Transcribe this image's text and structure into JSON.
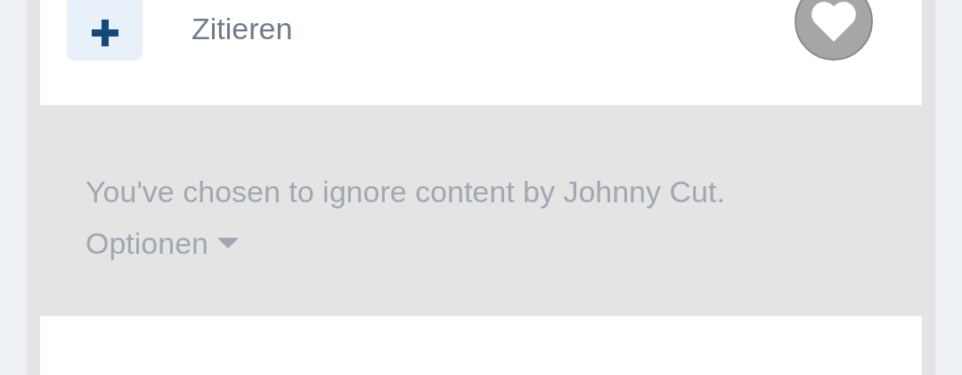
{
  "post_actions": {
    "quote_label": "Zitieren",
    "liked": false
  },
  "ignored_notice": {
    "message": "You've chosen to ignore content by Johnny Cut.",
    "options_label": "Optionen"
  }
}
